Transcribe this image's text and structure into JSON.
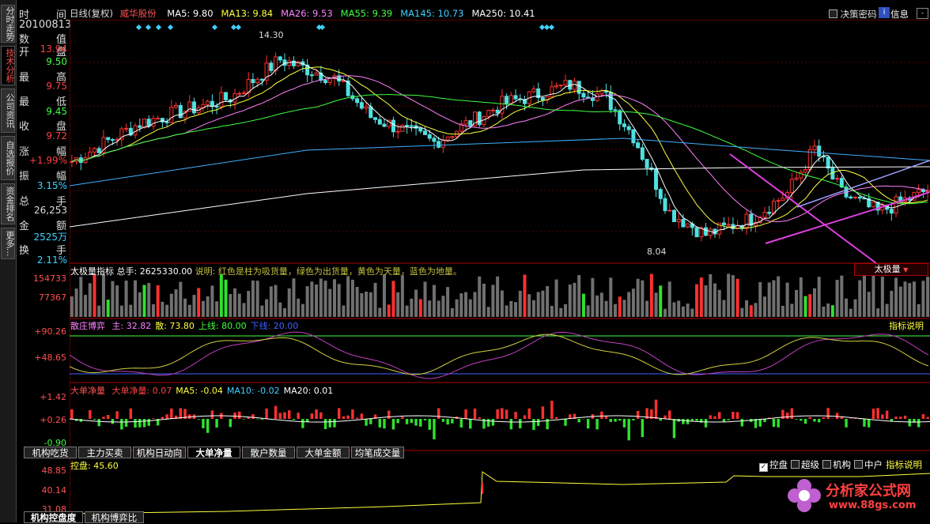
{
  "left_tabs": [
    {
      "label": "分时走势",
      "active": false
    },
    {
      "label": "技术分析",
      "active": true
    },
    {
      "label": "公司资讯",
      "active": false
    },
    {
      "label": "自选报价",
      "active": false
    },
    {
      "label": "资金排名",
      "active": false
    },
    {
      "label": "更多...",
      "active": false
    }
  ],
  "data_panel": {
    "rows": [
      {
        "l": "时",
        "r": "间",
        "v": "",
        "c": "#ddd"
      },
      {
        "l": "20100813",
        "r": "",
        "v": "",
        "c": "#ddd"
      },
      {
        "l": "数",
        "r": "值",
        "v": "",
        "c": "#ddd"
      },
      {
        "l": "开",
        "r": "盘",
        "v": "13.94",
        "c": "#ff4040"
      },
      {
        "l": "",
        "r": "",
        "v": "9.50",
        "c": "#40ff40"
      },
      {
        "l": "最",
        "r": "高",
        "v": "",
        "c": "#ddd"
      },
      {
        "l": "",
        "r": "",
        "v": "9.75",
        "c": "#ff4040"
      },
      {
        "l": "最",
        "r": "低",
        "v": "",
        "c": "#ddd"
      },
      {
        "l": "",
        "r": "",
        "v": "9.45",
        "c": "#40ff40"
      },
      {
        "l": "收",
        "r": "盘",
        "v": "",
        "c": "#ddd"
      },
      {
        "l": "",
        "r": "",
        "v": "9.72",
        "c": "#ff4040"
      },
      {
        "l": "涨",
        "r": "幅",
        "v": "",
        "c": "#ddd"
      },
      {
        "l": "",
        "r": "",
        "v": "+1.99%",
        "c": "#ff4040"
      },
      {
        "l": "振",
        "r": "幅",
        "v": "",
        "c": "#ddd"
      },
      {
        "l": "",
        "r": "",
        "v": "3.15%",
        "c": "#40d0ff"
      },
      {
        "l": "总",
        "r": "手",
        "v": "",
        "c": "#ddd"
      },
      {
        "l": "",
        "r": "",
        "v": "26,253",
        "c": "#ddd"
      },
      {
        "l": "金",
        "r": "额",
        "v": "",
        "c": "#ddd"
      },
      {
        "l": "",
        "r": "",
        "v": "2525万",
        "c": "#40d0ff"
      },
      {
        "l": "换",
        "r": "手",
        "v": "",
        "c": "#ddd"
      },
      {
        "l": "",
        "r": "",
        "v": "2.11%",
        "c": "#40d0ff"
      }
    ]
  },
  "title_bar": {
    "period": "日线(复权)",
    "stock": "威华股份",
    "ma": [
      {
        "label": "MA5: 9.80",
        "color": "#ffffff"
      },
      {
        "label": "MA13: 9.84",
        "color": "#ffff40"
      },
      {
        "label": "MA26: 9.53",
        "color": "#ff80ff"
      },
      {
        "label": "MA55: 9.39",
        "color": "#40ff40"
      },
      {
        "label": "MA145: 10.73",
        "color": "#40d0ff"
      },
      {
        "label": "MA250: 10.41",
        "color": "#ffffff"
      }
    ],
    "checkbox": "决策密码",
    "info_btn": "信息"
  },
  "price_panel": {
    "high_note": "14.30",
    "low_note": "8.04"
  },
  "vol_panel": {
    "header": "太极量指标",
    "total": "总手: 2625330.00",
    "desc": "说明: 红色是柱为吸货量，绿色为出货量，黄色为天量，蓝色为地量。",
    "selector": "太极量",
    "axis": [
      "154733",
      "77367"
    ]
  },
  "game_panel": {
    "header": "散庄博弈",
    "items": [
      {
        "label": "主: 32.82",
        "color": "#ff80ff"
      },
      {
        "label": "散: 73.80",
        "color": "#ffff40"
      },
      {
        "label": "上线: 80.00",
        "color": "#40ff40"
      },
      {
        "label": "下线: 20.00",
        "color": "#4060ff"
      }
    ],
    "axis": [
      "+90.26",
      "+48.65"
    ],
    "link": "指标说明"
  },
  "big_panel": {
    "header": "大单净量",
    "items": [
      {
        "label": "大单净量: 0.07",
        "color": "#ff4040"
      },
      {
        "label": "MA5: -0.04",
        "color": "#ffff40"
      },
      {
        "label": "MA10: -0.02",
        "color": "#40d0ff"
      },
      {
        "label": "MA20: 0.01",
        "color": "#ffffff"
      }
    ],
    "axis": [
      "+1.42",
      "+0.26",
      "-0.90"
    ]
  },
  "mid_tabs": [
    {
      "label": "机构吃货",
      "active": false
    },
    {
      "label": "主力买卖",
      "active": false
    },
    {
      "label": "机构日动向",
      "active": false
    },
    {
      "label": "大单净量",
      "active": true
    },
    {
      "label": "散户数量",
      "active": false
    },
    {
      "label": "大单金额",
      "active": false
    },
    {
      "label": "均笔成交量",
      "active": false
    }
  ],
  "ctrl_panel": {
    "header": "控盘: 45.60",
    "axis": [
      "48.85",
      "40.14",
      "31.08"
    ],
    "options": [
      {
        "label": "控盘",
        "checked": true
      },
      {
        "label": "超级",
        "checked": false
      },
      {
        "label": "机构",
        "checked": false
      },
      {
        "label": "中户",
        "checked": false
      }
    ],
    "link": "指标说明"
  },
  "bottom_tabs": [
    {
      "label": "机构控盘度",
      "active": true
    },
    {
      "label": "机构博弈比",
      "active": false
    }
  ],
  "watermark": {
    "title": "分析家公式网",
    "url": "www.88gs.com"
  },
  "chart_data": {
    "type": "candlestick",
    "title": "威华股份",
    "period": "日线(复权)",
    "last_date": "20100813",
    "ohlc_last": {
      "open": 9.5,
      "high": 9.75,
      "low": 9.45,
      "close": 9.72
    },
    "marked_high": 14.3,
    "marked_low": 8.04,
    "moving_averages": {
      "MA5": 9.8,
      "MA13": 9.84,
      "MA26": 9.53,
      "MA55": 9.39,
      "MA145": 10.73,
      "MA250": 10.41
    },
    "volume_axis": [
      77367,
      154733
    ],
    "game_axis": [
      48.65,
      90.26
    ],
    "big_order_axis": [
      -0.9,
      0.26,
      1.42
    ],
    "control_axis": [
      31.08,
      40.14,
      48.85
    ]
  }
}
